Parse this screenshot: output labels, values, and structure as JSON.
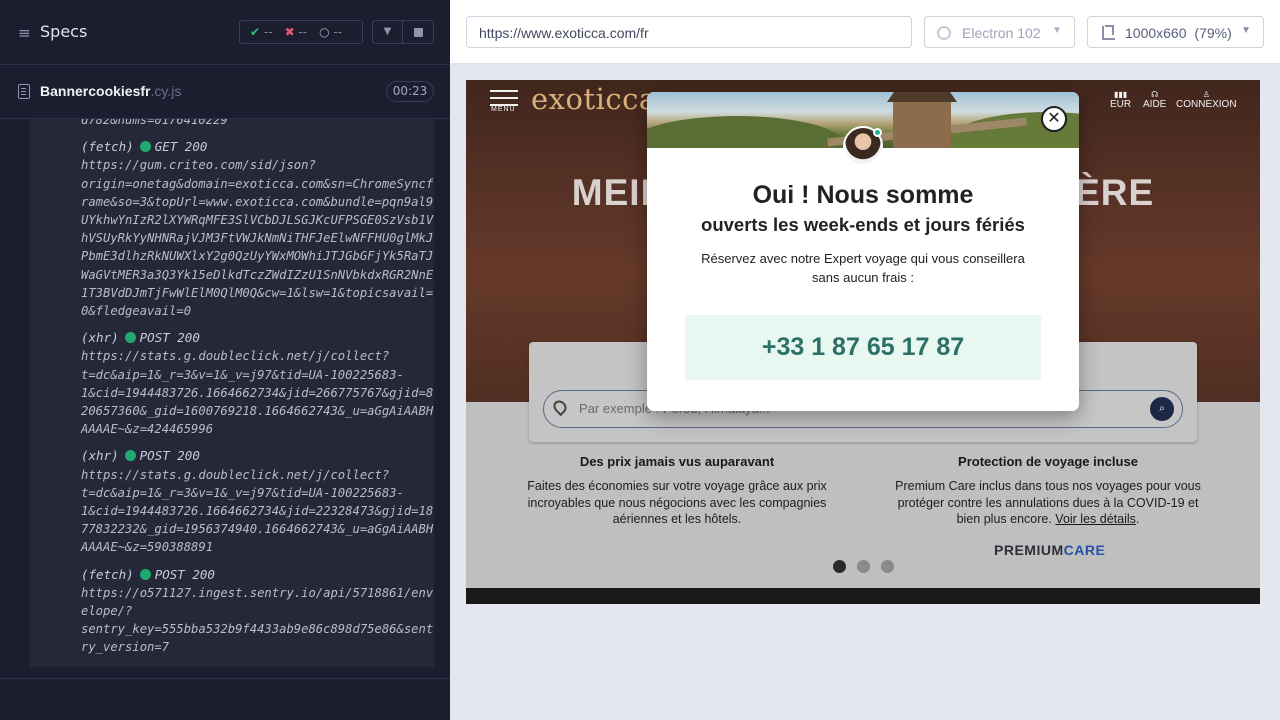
{
  "runner": {
    "specs_label": "Specs",
    "stats": {
      "passed": "--",
      "failed": "--",
      "pending": "--"
    },
    "spec_file": {
      "name": "Bannercookiesfr",
      "ext": ".cy.js",
      "duration": "00:23"
    },
    "log_top_fragment": "d782&nums=0176410229",
    "requests": [
      {
        "type": "(fetch)",
        "method_status": "GET 200",
        "lines": [
          "https://gum.criteo.com/sid/json?",
          "origin=onetag&domain=exoticca.com&sn=ChromeSyncf",
          "rame&so=3&topUrl=www.exoticca.com&bundle=pqn9al9",
          "UYkhwYnIzR2lXYWRqMFE3SlVCbDJLSGJKcUFPSGE0SzVsb1V",
          "hVSUyRkYyNHNRajVJM3FtVWJkNmNiTHFJeElwNFFHU0glMkJ",
          "PbmE3dlhzRkNUWXlxY2g0QzUyYWxMOWhiJTJGbGFjYk5RaTJ",
          "WaGVtMER3a3Q3Yk15eDlkdTczZWdIZzU1SnNVbkdxRGR2NnE",
          "1T3BVdDJmTjFwWlElM0QlM0Q&cw=1&lsw=1&topicsavail=",
          "0&fledgeavail=0"
        ]
      },
      {
        "type": "(xhr)",
        "method_status": "POST 200",
        "lines": [
          "https://stats.g.doubleclick.net/j/collect?",
          "t=dc&aip=1&_r=3&v=1&_v=j97&tid=UA-100225683-",
          "1&cid=1944483726.1664662734&jid=266775767&gjid=8",
          "20657360&_gid=1600769218.1664662743&_u=aGgAiAABH",
          "AAAAE~&z=424465996"
        ]
      },
      {
        "type": "(xhr)",
        "method_status": "POST 200",
        "lines": [
          "https://stats.g.doubleclick.net/j/collect?",
          "t=dc&aip=1&_r=3&v=1&_v=j97&tid=UA-100225683-",
          "1&cid=1944483726.1664662734&jid=22328473&gjid=18",
          "77832232&_gid=1956374940.1664662743&_u=aGgAiAABH",
          "AAAAE~&z=590388891"
        ]
      },
      {
        "type": "(fetch)",
        "method_status": "POST 200",
        "lines": [
          "https://o571127.ingest.sentry.io/api/5718861/env",
          "elope/?",
          "sentry_key=555bba532b9f4433ab9e86c898d75e86&sent",
          "ry_version=7"
        ]
      }
    ]
  },
  "topbar": {
    "url": "https://www.exoticca.com/fr",
    "browser": "Electron 102",
    "viewport": "1000x660",
    "zoom": "(79%)"
  },
  "site": {
    "menu_label": "MENU",
    "logo": "exoticca",
    "nav": {
      "currency": "EUR",
      "help": "AIDE",
      "login": "CONNEXION"
    },
    "hero_title": "MEILL RNIÈRE",
    "search_placeholder": "Par exemple : Pérou, Himalaya...",
    "features": [
      {
        "title": "Des prix jamais vus auparavant",
        "desc": "Faites des économies sur votre voyage grâce aux prix incroyables que nous négocions avec les compagnies aériennes et les hôtels."
      },
      {
        "title": "Protection de voyage incluse",
        "desc": "Premium Care inclus dans tous nos voyages pour vous protéger contre les annulations dues à la COVID-19 et bien plus encore.",
        "link": "Voir les détails"
      }
    ],
    "premium_a": "PREMIUM",
    "premium_b": "CARE",
    "carousel_active": 1
  },
  "modal": {
    "title": "Oui ! Nous somme",
    "subtitle": "ouverts les week-ends et jours fériés",
    "text": "Réservez avec notre Expert voyage qui vous conseillera sans aucun frais :",
    "phone": "+33 1 87 65 17 87",
    "close": "✕"
  },
  "colors": {
    "runner_bg": "#1b1e2e",
    "pass": "#3dbb78",
    "fail": "#e45770",
    "status_dot": "#1fa971",
    "phone_bg": "#e8f7f0",
    "phone_text": "#2c6f66"
  }
}
